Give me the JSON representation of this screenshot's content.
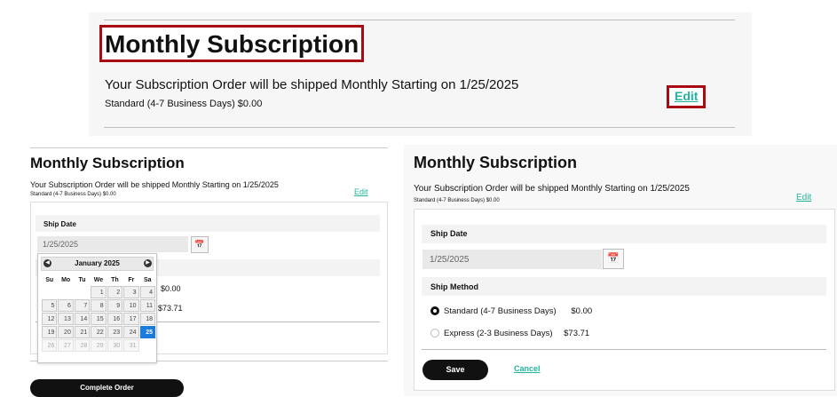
{
  "top": {
    "title": "Monthly Subscription",
    "message": "Your Subscription Order will be shipped Monthly Starting on 1/25/2025",
    "shipping": "Standard (4-7 Business Days) $0.00",
    "edit_label": "Edit"
  },
  "left": {
    "title": "Monthly Subscription",
    "message": "Your Subscription Order will be shipped Monthly Starting on 1/25/2025",
    "shipping": "Standard (4-7 Business Days) $0.00",
    "edit_label": "Edit",
    "ship_date_label": "Ship Date",
    "ship_date_value": "1/25/2025",
    "price_standard": "$0.00",
    "price_express": "$73.71",
    "complete_label": "Complete Order",
    "calendar": {
      "month": "January 2025",
      "weekdays": [
        "Su",
        "Mo",
        "Tu",
        "We",
        "Th",
        "Fr",
        "Sa"
      ],
      "weeks": [
        [
          "",
          "",
          "",
          "1",
          "2",
          "3",
          "4"
        ],
        [
          "5",
          "6",
          "7",
          "8",
          "9",
          "10",
          "11"
        ],
        [
          "12",
          "13",
          "14",
          "15",
          "16",
          "17",
          "18"
        ],
        [
          "19",
          "20",
          "21",
          "22",
          "23",
          "24",
          "25"
        ],
        [
          "26",
          "27",
          "28",
          "29",
          "30",
          "31",
          ""
        ]
      ],
      "selected": "25"
    }
  },
  "right": {
    "title": "Monthly Subscription",
    "message": "Your Subscription Order will be shipped Monthly Starting on 1/25/2025",
    "shipping": "Standard (4-7 Business Days) $0.00",
    "edit_label": "Edit",
    "ship_date_label": "Ship Date",
    "ship_date_value": "1/25/2025",
    "ship_method_label": "Ship Method",
    "options": [
      {
        "label": "Standard (4-7 Business Days)",
        "price": "$0.00",
        "selected": true
      },
      {
        "label": "Express (2-3 Business Days)",
        "price": "$73.71",
        "selected": false
      }
    ],
    "save_label": "Save",
    "cancel_label": "Cancel"
  },
  "colors": {
    "accent": "#21b4a0",
    "highlight": "#a80c12",
    "selected_day": "#1a7bdc"
  },
  "icons": {
    "calendar": "calendar-icon",
    "prev": "chevron-left-icon",
    "next": "chevron-right-icon"
  }
}
